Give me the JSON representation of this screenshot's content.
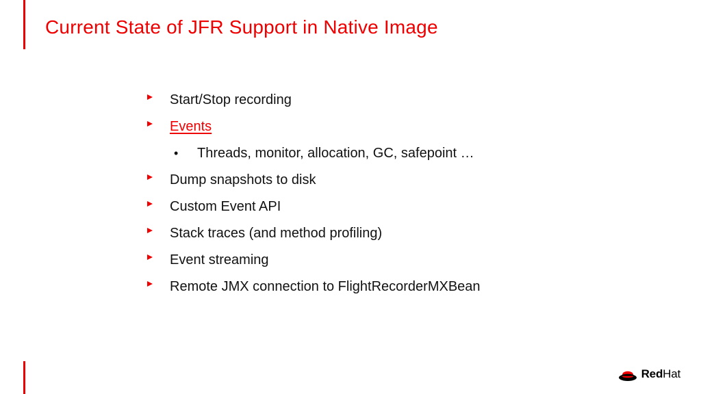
{
  "title": "Current State of JFR Support in Native Image",
  "bullets": {
    "b0": "Start/Stop recording",
    "b1": "Events",
    "b1_sub": "Threads, monitor, allocation, GC, safepoint …",
    "b2": "Dump snapshots to disk",
    "b3": "Custom Event API",
    "b4": "Stack traces (and method profiling)",
    "b5": "Event streaming",
    "b6": "Remote JMX connection to FlightRecorderMXBean"
  },
  "logo": {
    "brand1": "Red",
    "brand2": "Hat"
  }
}
